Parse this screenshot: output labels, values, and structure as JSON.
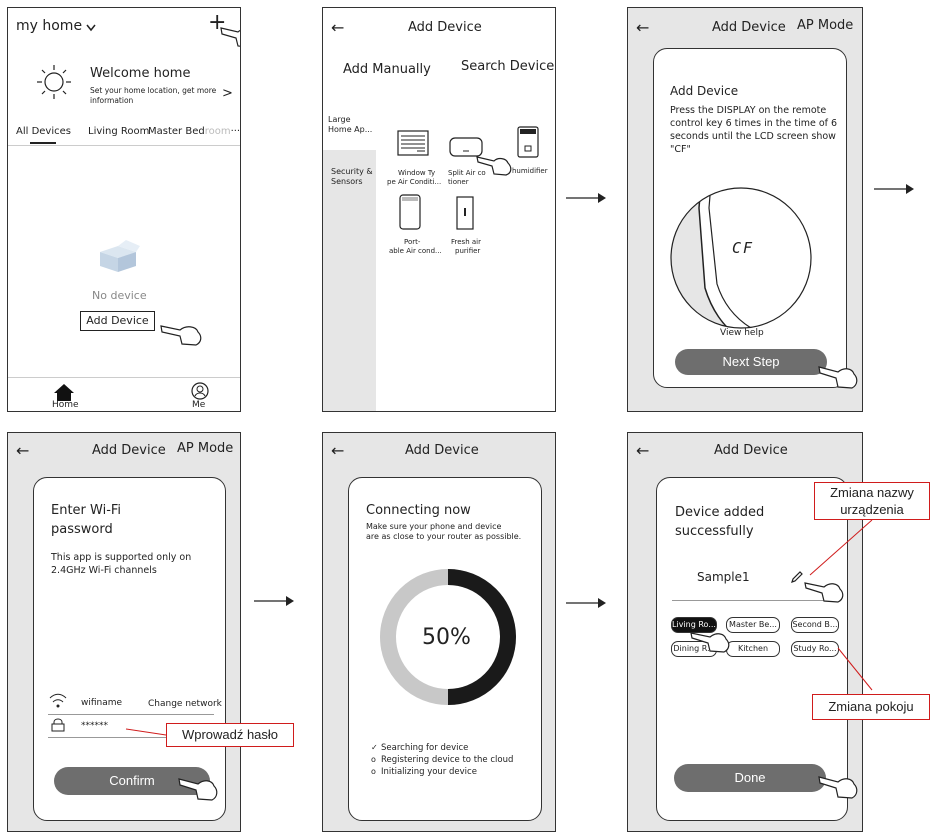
{
  "screen1": {
    "home_selector": "my home",
    "welcome_title": "Welcome home",
    "welcome_sub_line1": "Set your home location, get more",
    "welcome_sub_line2": "information",
    "welcome_chevron": ">",
    "tabs": [
      "All Devices",
      "Living Room",
      "Master Bed",
      "room"
    ],
    "empty_label": "No device",
    "add_device_button": "Add Device",
    "nav_home": "Home",
    "nav_me": "Me"
  },
  "screen2": {
    "title": "Add Device",
    "tab_manual": "Add Manually",
    "tab_search": "Search Device",
    "category_large_line1": "Large",
    "category_large_line2": "Home Ap...",
    "category_security_line1": "Security &",
    "category_security_line2": "Sensors",
    "devices": [
      {
        "line1": "Window Ty",
        "line2": "pe Air Conditi..."
      },
      {
        "line1": "Split Air co",
        "line2": "tioner"
      },
      {
        "line1": "humidifier",
        "line2": ""
      },
      {
        "line1": "Port-",
        "line2": "able Air cond..."
      },
      {
        "line1": "Fresh air",
        "line2": "purifier"
      }
    ]
  },
  "screen3": {
    "title": "Add Device",
    "mode": "AP Mode",
    "card_title": "Add Device",
    "instructions": [
      "Press the DISPLAY on the remote",
      "control key 6 times in the time of 6",
      "seconds until the LCD screen show",
      "\"CF\""
    ],
    "lcd_text": "CF",
    "view_help": "View help",
    "next_button": "Next Step"
  },
  "screen4": {
    "title": "Add Device",
    "mode": "AP Mode",
    "heading_line1": "Enter Wi-Fi",
    "heading_line2": "password",
    "note_line1": "This app is supported only on",
    "note_line2": "2.4GHz Wi-Fi channels",
    "wifi_name": "wifiname",
    "change_network": "Change network",
    "password_mask": "******",
    "confirm_button": "Confirm",
    "callout_password": "Wprowadź hasło"
  },
  "screen5": {
    "title": "Add Device",
    "heading": "Connecting now",
    "sub_line1": "Make sure your phone and device",
    "sub_line2": "are as close to your router as possible.",
    "progress_percent": "50%",
    "progress_fraction": 0.5,
    "steps": [
      {
        "mark": "✓",
        "text": "Searching for device"
      },
      {
        "mark": "o",
        "text": "Registering device to the cloud"
      },
      {
        "mark": "o",
        "text": "Initializing your device"
      }
    ]
  },
  "screen6": {
    "title": "Add Device",
    "heading_line1": "Device added",
    "heading_line2": "successfully",
    "device_name": "Sample1",
    "rooms": [
      "Living Ro...",
      "Master Be...",
      "Second B...",
      "Dining R...",
      "Kitchen",
      "Study Ro..."
    ],
    "selected_room": "Living Ro...",
    "done_button": "Done",
    "callout_rename_line1": "Zmiana nazwy",
    "callout_rename_line2": "urządzenia",
    "callout_room": "Zmiana pokoju"
  },
  "arrow_glyph": "→",
  "colors": {
    "pill": "#6e6e6e",
    "callout_border": "#d01c1c",
    "panel_gray": "#e6e6e6"
  }
}
